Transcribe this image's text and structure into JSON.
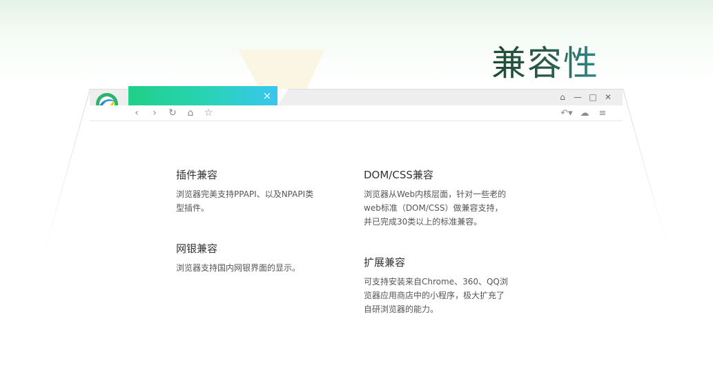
{
  "hero": {
    "title": "兼容性"
  },
  "browser": {
    "tab": {
      "close_glyph": "×"
    },
    "window_controls": [
      {
        "name": "skin-icon",
        "glyph": "⌂"
      },
      {
        "name": "minimize-icon",
        "glyph": "—"
      },
      {
        "name": "maximize-icon",
        "glyph": "□"
      },
      {
        "name": "close-icon",
        "glyph": "✕"
      }
    ],
    "nav": [
      {
        "name": "back-icon",
        "glyph": "‹"
      },
      {
        "name": "forward-icon",
        "glyph": "›"
      },
      {
        "name": "refresh-icon",
        "glyph": "↻"
      },
      {
        "name": "home-icon",
        "glyph": "⌂"
      },
      {
        "name": "favorite-icon",
        "glyph": "☆"
      }
    ],
    "tools": [
      {
        "name": "undo-icon",
        "glyph": "↶▾"
      },
      {
        "name": "cloud-icon",
        "glyph": "☁"
      },
      {
        "name": "menu-icon",
        "glyph": "≡"
      }
    ]
  },
  "features": [
    {
      "title": "插件兼容",
      "lines": [
        "浏览器完美支持PPAPI、以及NPAPI类",
        "型插件。"
      ]
    },
    {
      "title": "DOM/CSS兼容",
      "lines": [
        "浏览器从Web内核层面，针对一些老的",
        "web标准（DOM/CSS）做兼容支持，",
        "并已完成30类以上的标准兼容。"
      ]
    },
    {
      "title": "网银兼容",
      "lines": [
        "浏览器支持国内网银界面的显示。"
      ]
    },
    {
      "title": "扩展兼容",
      "lines": [
        "可支持安装来自Chrome、360、QQ浏",
        "览器应用商店中的小程序，极大扩充了",
        "自研浏览器的能力。"
      ]
    }
  ]
}
